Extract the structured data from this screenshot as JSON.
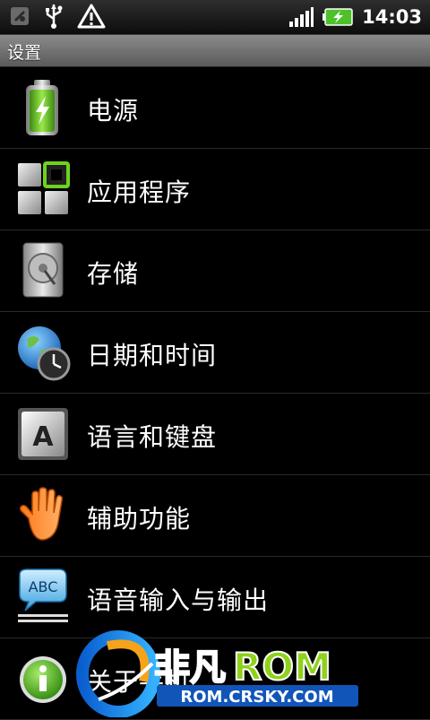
{
  "status_bar": {
    "time": "14:03",
    "icons": [
      "satellite-icon",
      "usb-icon",
      "warning-icon",
      "signal-icon",
      "battery-charging-icon"
    ]
  },
  "title_bar": {
    "title": "设置"
  },
  "settings": {
    "items": [
      {
        "label": "电源",
        "icon": "battery-icon"
      },
      {
        "label": "应用程序",
        "icon": "applications-icon"
      },
      {
        "label": "存储",
        "icon": "storage-icon"
      },
      {
        "label": "日期和时间",
        "icon": "globe-clock-icon"
      },
      {
        "label": "语言和键盘",
        "icon": "keyboard-key-icon"
      },
      {
        "label": "辅助功能",
        "icon": "hand-icon"
      },
      {
        "label": "语音输入与输出",
        "icon": "speech-bubble-icon"
      },
      {
        "label": "关于手机",
        "icon": "info-icon"
      }
    ]
  },
  "watermark": {
    "brand": "非凡ROM",
    "url": "ROM.CRSKY.COM"
  },
  "colors": {
    "accent_green": "#6dd41d",
    "title_bar_grey": "#7a7a7a"
  }
}
